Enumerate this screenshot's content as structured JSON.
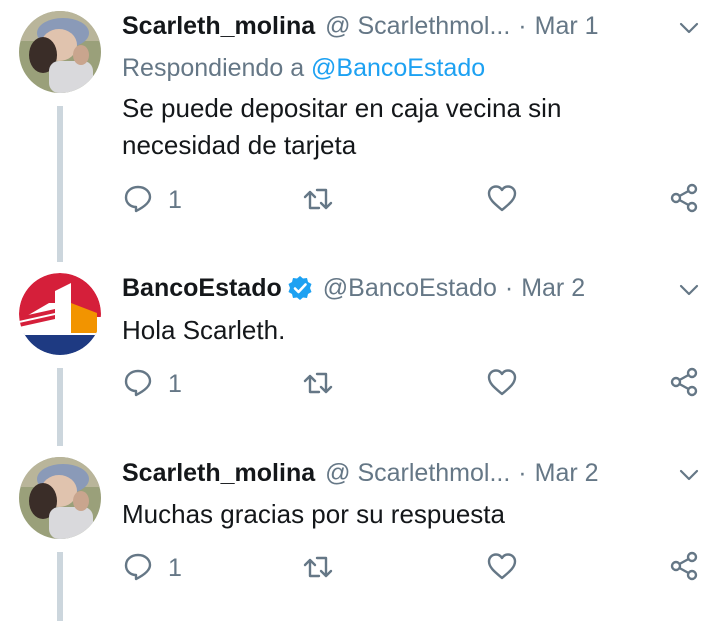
{
  "tweets": [
    {
      "name": "Scarleth_molina",
      "handle": "@ Scarlethmol...",
      "date": "Mar 1",
      "reply_prefix": "Respondiendo a ",
      "reply_mention": "@BancoEstado",
      "text_lines": [
        "Se puede depositar en caja vecina sin",
        "necesidad de tarjeta"
      ],
      "reply_count": "1",
      "avatar": "user-photo"
    },
    {
      "name": "BancoEstado",
      "handle": "@BancoEstado",
      "date": "Mar 2",
      "verified": true,
      "text_lines": [
        "Hola Scarleth."
      ],
      "reply_count": "1",
      "avatar": "bancoestado-logo"
    },
    {
      "name": "Scarleth_molina",
      "handle": "@ Scarlethmol...",
      "date": "Mar 2",
      "text_lines": [
        "Muchas gracias por su respuesta"
      ],
      "reply_count": "1",
      "avatar": "user-photo"
    }
  ],
  "separator": "·",
  "icons": {
    "reply": "reply-icon",
    "retweet": "retweet-icon",
    "like": "heart-icon",
    "share": "share-icon",
    "caret": "chevron-down-icon",
    "verified": "verified-badge-icon"
  },
  "colors": {
    "text": "#14171a",
    "secondary": "#657786",
    "link": "#1da1f2",
    "thread_line": "#ccd6dd",
    "verified": "#1da1f2"
  }
}
